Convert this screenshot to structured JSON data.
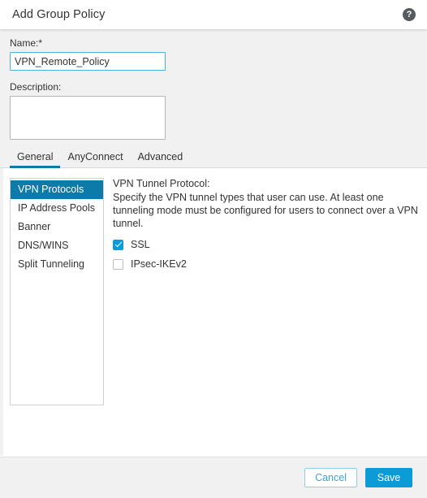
{
  "header": {
    "title": "Add Group Policy",
    "help_icon": "help-circle-icon",
    "help_glyph": "?"
  },
  "form": {
    "name_label": "Name:*",
    "name_value": "VPN_Remote_Policy",
    "name_placeholder": "",
    "description_label": "Description:",
    "description_value": "",
    "description_placeholder": ""
  },
  "tabs": [
    {
      "label": "General",
      "active": true
    },
    {
      "label": "AnyConnect",
      "active": false
    },
    {
      "label": "Advanced",
      "active": false
    }
  ],
  "nav": {
    "items": [
      {
        "label": "VPN Protocols",
        "selected": true
      },
      {
        "label": "IP Address Pools",
        "selected": false
      },
      {
        "label": "Banner",
        "selected": false
      },
      {
        "label": "DNS/WINS",
        "selected": false
      },
      {
        "label": "Split Tunneling",
        "selected": false
      }
    ]
  },
  "detail": {
    "title": "VPN Tunnel Protocol:",
    "description": "Specify the VPN tunnel types that user can use. At least one tunneling mode must be configured for users to connect over a VPN tunnel.",
    "checkboxes": [
      {
        "label": "SSL",
        "checked": true
      },
      {
        "label": "IPsec-IKEv2",
        "checked": false
      }
    ]
  },
  "footer": {
    "cancel_label": "Cancel",
    "save_label": "Save"
  },
  "colors": {
    "accent_blue": "#0d9bd8",
    "selected_blue": "#0d7ba8",
    "focus_border": "#4db0dd",
    "body_bg": "#f1f1f1",
    "text": "#333333"
  }
}
